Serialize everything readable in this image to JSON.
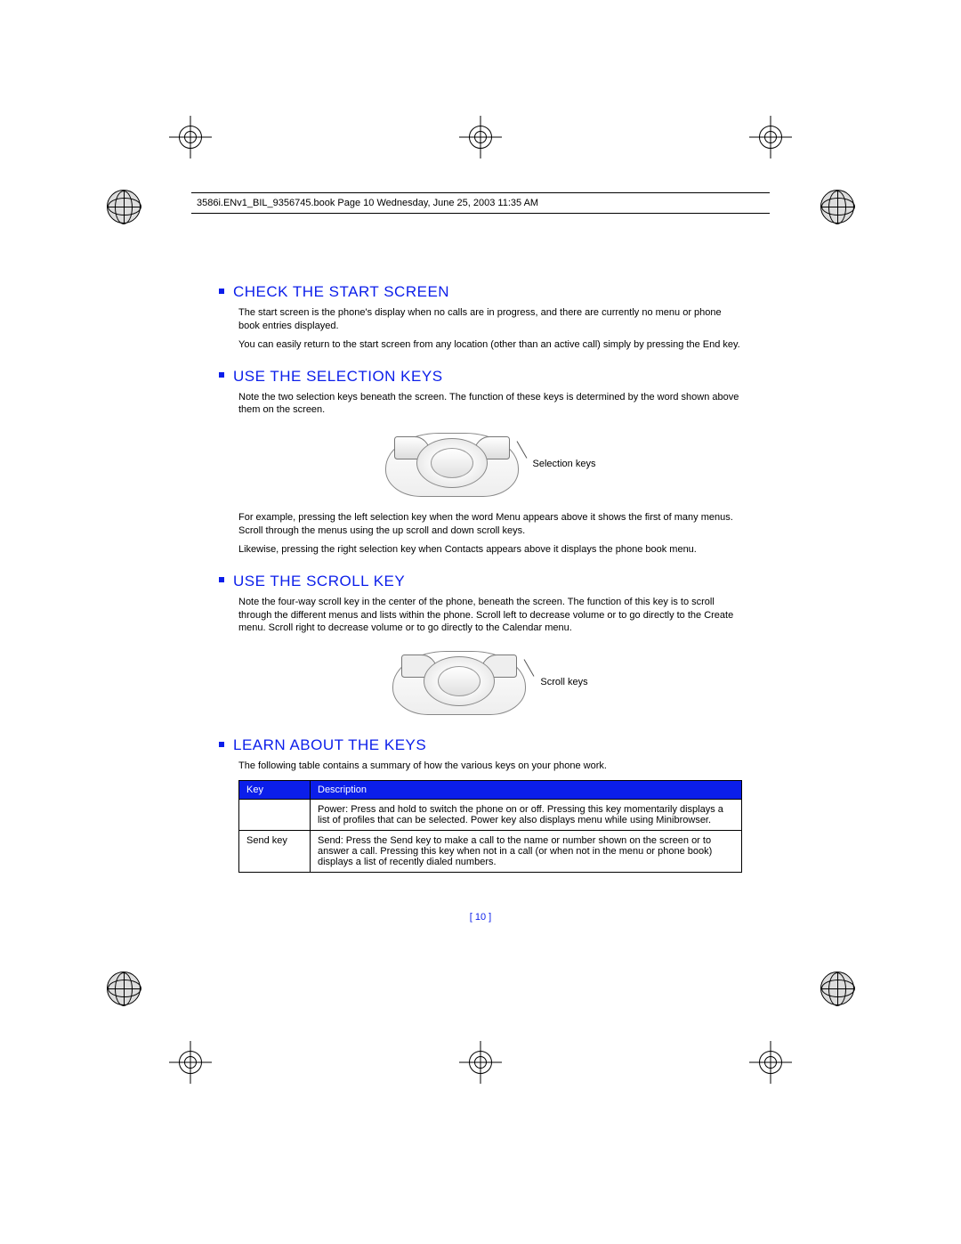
{
  "header": {
    "line": "3586i.ENv1_BIL_9356745.book  Page 10  Wednesday, June 25, 2003  11:35 AM"
  },
  "sections": {
    "s1": {
      "title": "Check the start screen",
      "p1": "The start screen is the phone's display when no calls are in progress, and there are currently no menu or phone book entries displayed.",
      "p2": "You can easily return to the start screen from any location (other than an active call) simply by pressing the End key."
    },
    "s2": {
      "title": "Use the selection keys",
      "p1": "Note the two selection keys beneath the screen. The function of these keys is determined by the word shown above them on the screen.",
      "caption": "Selection keys",
      "p2": "For example, pressing the left selection key when the word Menu appears above it shows the first of many menus. Scroll through the menus using the up scroll and down scroll keys.",
      "p3": "Likewise, pressing the right selection key when Contacts appears above it displays the phone book menu."
    },
    "s3": {
      "title": "Use the scroll key",
      "p1": "Note the four-way scroll key in the center of the phone, beneath the screen. The function of this key is to scroll through the different menus and lists within the phone. Scroll left to decrease volume or to go directly to the Create menu. Scroll right to decrease volume or to go directly to the Calendar menu.",
      "caption": "Scroll keys"
    },
    "s4": {
      "title": "Learn about the keys",
      "p1": "The following table contains a summary of how the various keys on your phone work."
    }
  },
  "table": {
    "head_key": "Key",
    "head_desc": "Description",
    "rows": [
      {
        "key": "",
        "desc": "Power: Press and hold to switch the phone on or off. Pressing this key momentarily displays a list of profiles that can be selected. Power key also displays menu while using Minibrowser."
      },
      {
        "key": "Send key",
        "desc": "Send: Press the Send key to make a call to the name or number shown on the screen or to answer a call. Pressing this key when not in a call (or when not in the menu or phone book) displays a list of recently dialed numbers."
      }
    ]
  },
  "footer": {
    "page": "[ 10 ]"
  }
}
